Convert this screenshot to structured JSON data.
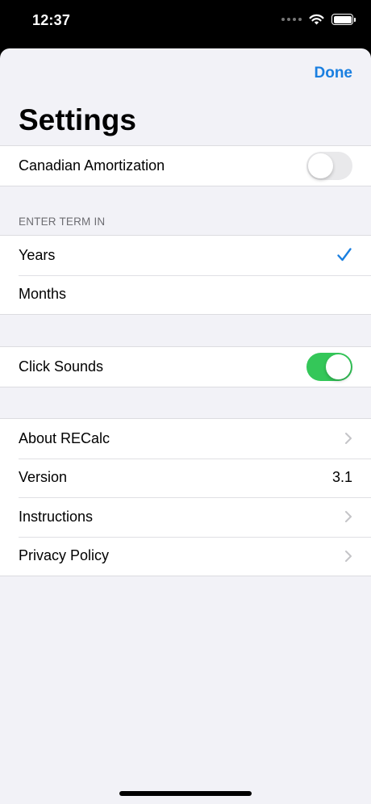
{
  "status": {
    "time": "12:37",
    "icons": [
      "cellular-dots-icon",
      "wifi-icon",
      "battery-icon"
    ]
  },
  "header": {
    "done_label": "Done",
    "title": "Settings"
  },
  "canadian": {
    "label": "Canadian Amortization",
    "enabled": false
  },
  "term": {
    "header": "ENTER TERM IN",
    "options": [
      {
        "label": "Years",
        "selected": true
      },
      {
        "label": "Months",
        "selected": false
      }
    ]
  },
  "sounds": {
    "label": "Click Sounds",
    "enabled": true
  },
  "info": {
    "about_label": "About RECalc",
    "version_label": "Version",
    "version_value": "3.1",
    "instructions_label": "Instructions",
    "privacy_label": "Privacy Policy"
  },
  "colors": {
    "accent": "#1a7fe0",
    "toggle_on": "#34c759",
    "toggle_off": "#e9e9eb",
    "background": "#f2f2f7"
  }
}
